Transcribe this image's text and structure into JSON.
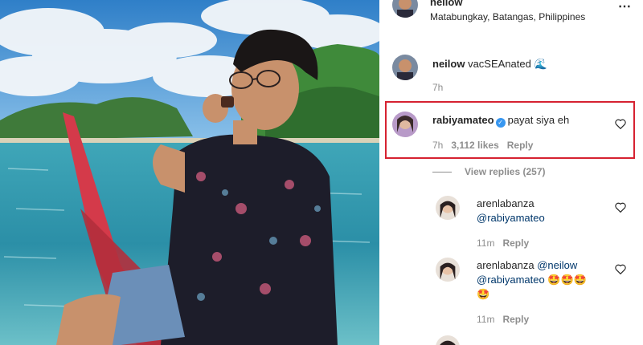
{
  "post": {
    "username": "neilow",
    "location": "Matabungkay, Batangas, Philippines",
    "more_icon": "more-icon"
  },
  "caption": {
    "username": "neilow",
    "text": "vacSEAnated",
    "emoji": "🌊",
    "time": "7h"
  },
  "comments": [
    {
      "username": "rabiyamateo",
      "verified": true,
      "text": "payat siya eh",
      "time": "7h",
      "likes": "3,112 likes",
      "reply_label": "Reply",
      "view_replies": "View replies (257)"
    },
    {
      "username": "arenlabanza",
      "text": "@rabiyamateo",
      "time": "11m",
      "reply_label": "Reply"
    },
    {
      "username": "arenlabanza",
      "text": "@neilow",
      "text2": "@rabiyamateo",
      "emoji_inline": "🤩🤩🤩",
      "emoji_line": "🤩",
      "time": "11m",
      "reply_label": "Reply"
    }
  ],
  "colors": {
    "highlight": "#d62231",
    "verified": "#3897f0"
  }
}
